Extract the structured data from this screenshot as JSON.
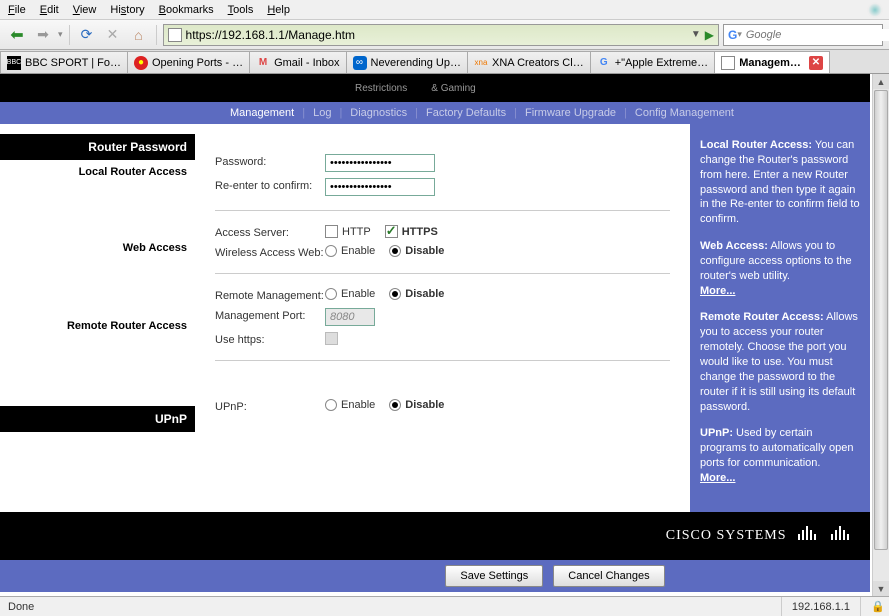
{
  "menu": {
    "file": "File",
    "edit": "Edit",
    "view": "View",
    "history": "History",
    "bookmarks": "Bookmarks",
    "tools": "Tools",
    "help": "Help"
  },
  "url": "https://192.168.1.1/Manage.htm",
  "search_placeholder": "Google",
  "tabs": [
    {
      "label": "BBC SPORT | Fo…",
      "fav": "BBC"
    },
    {
      "label": "Opening Ports - …",
      "fav": "MU"
    },
    {
      "label": "Gmail - Inbox",
      "fav": "M"
    },
    {
      "label": "Neverending Up…",
      "fav": "∞"
    },
    {
      "label": "XNA Creators Cl…",
      "fav": "xna"
    },
    {
      "label": "+\"Apple Extreme…",
      "fav": "G"
    },
    {
      "label": "Managem…",
      "fav": "□",
      "active": true
    }
  ],
  "top_row": {
    "restrictions": "Restrictions",
    "gaming": "& Gaming"
  },
  "subnav": {
    "management": "Management",
    "log": "Log",
    "diagnostics": "Diagnostics",
    "factory": "Factory Defaults",
    "firmware": "Firmware Upgrade",
    "config": "Config Management"
  },
  "sections": {
    "router_password": "Router Password",
    "local_access": "Local Router Access",
    "web_access": "Web Access",
    "remote_access": "Remote Router Access",
    "upnp": "UPnP"
  },
  "form": {
    "password_lbl": "Password:",
    "reenter_lbl": "Re-enter to confirm:",
    "password_val": "••••••••••••••••",
    "access_server_lbl": "Access Server:",
    "http": "HTTP",
    "https": "HTTPS",
    "wireless_lbl": "Wireless Access Web:",
    "enable": "Enable",
    "disable": "Disable",
    "remote_mgmt_lbl": "Remote Management:",
    "mgmt_port_lbl": "Management Port:",
    "mgmt_port_val": "8080",
    "use_https_lbl": "Use https:",
    "upnp_lbl": "UPnP:"
  },
  "help": {
    "p1_title": "Local Router Access:",
    "p1": " You can change the Router's password from here. Enter a new Router password and then type it again in the Re-enter to confirm field to confirm.",
    "p2_title": "Web Access:",
    "p2": " Allows you to configure access options to the router's web utility.",
    "p3_title": "Remote Router Access:",
    "p3": " Allows you to access your router remotely. Choose the port you would like to use. You must change the password to the router if it is still using its default password.",
    "p4_title": "UPnP:",
    "p4": " Used by certain programs to automatically open ports for communication.",
    "more": "More..."
  },
  "buttons": {
    "save": "Save Settings",
    "cancel": "Cancel Changes"
  },
  "logo": "CISCO SYSTEMS",
  "status": {
    "done": "Done",
    "ip": "192.168.1.1"
  }
}
